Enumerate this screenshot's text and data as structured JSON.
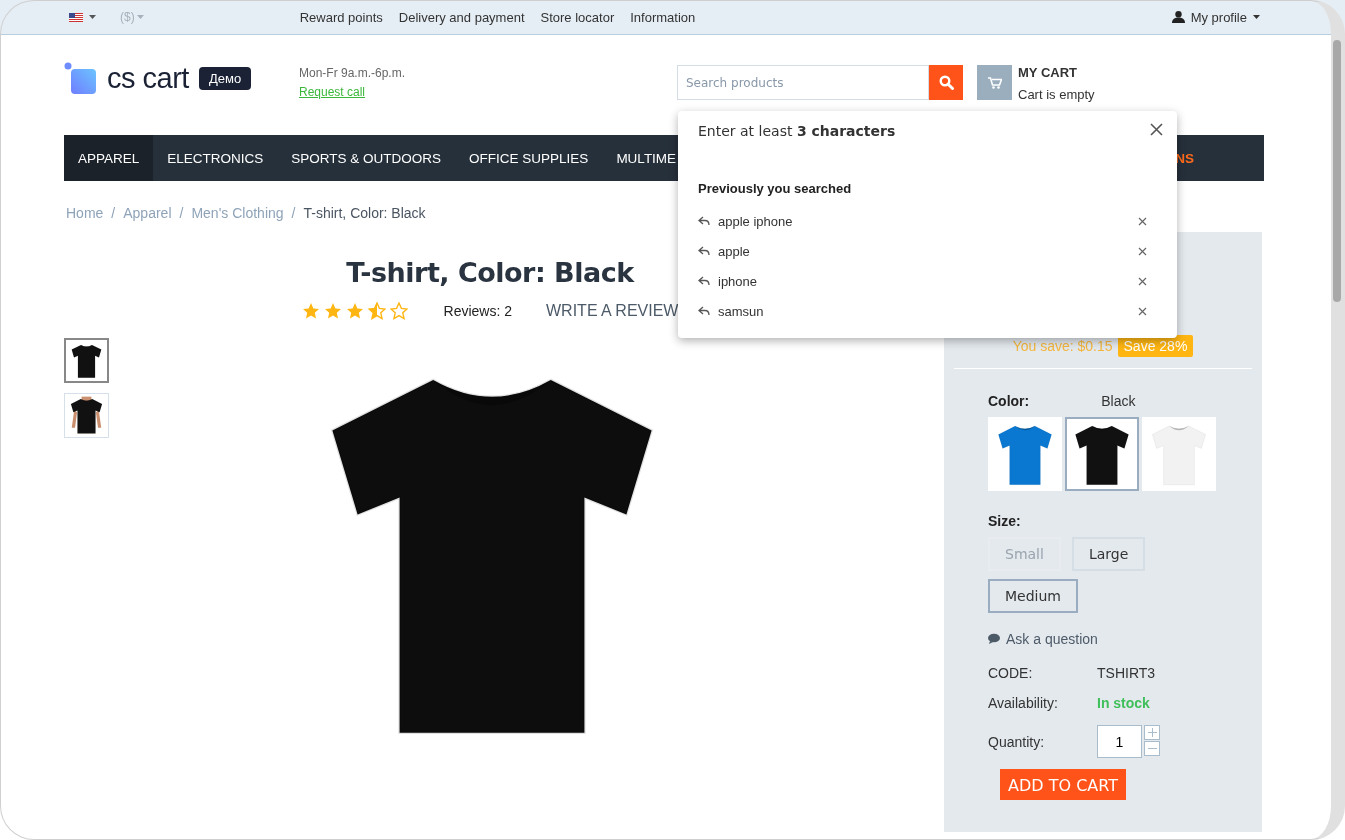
{
  "top_bar": {
    "language": {
      "kind": "flag"
    },
    "currency": {
      "label": "($)",
      "disabled": true
    },
    "links": [
      "Reward points",
      "Delivery and payment",
      "Store locator",
      "Information"
    ],
    "profile": "My profile"
  },
  "header": {
    "logo": {
      "text": "cs cart",
      "badge": "Демо"
    },
    "hours": "Mon-Fr 9a.m.-6p.m.",
    "request_call": "Request call",
    "search": {
      "placeholder": "Search products"
    },
    "cart": {
      "title": "MY CART",
      "status": "Cart is empty"
    }
  },
  "nav": [
    {
      "label": "APPAREL",
      "selected": true,
      "kind": "normal"
    },
    {
      "label": "ELECTRONICS",
      "selected": false,
      "kind": "normal"
    },
    {
      "label": "SPORTS & OUTDOORS",
      "selected": false,
      "kind": "normal"
    },
    {
      "label": "OFFICE SUPPLIES",
      "selected": false,
      "kind": "normal"
    },
    {
      "label": "MULTIME",
      "selected": false,
      "kind": "normal"
    },
    {
      "label": "NS",
      "selected": false,
      "kind": "promo"
    }
  ],
  "breadcrumbs": {
    "separator": "/",
    "items": [
      "Home",
      "Apparel",
      "Men's Clothing",
      "T-shirt, Color: Black"
    ]
  },
  "product": {
    "title": "T-shirt, Color: Black",
    "rating": {
      "stars": 3.5,
      "reviews": "Reviews: 2",
      "write_review": "WRITE A REVIEW"
    },
    "thumbnails": [
      {
        "kind": "picture",
        "selected": true
      },
      {
        "kind": "picture",
        "selected": false
      }
    ],
    "savings": {
      "text": "You save: $0.15",
      "badge": "Save 28%"
    },
    "color": {
      "label": "Color:",
      "value": "Black",
      "options": [
        {
          "kind": "picture",
          "color": "#0a78d0",
          "selected": false
        },
        {
          "kind": "picture",
          "color": "#111111",
          "selected": true
        },
        {
          "kind": "picture",
          "color": "#f2f2f2",
          "selected": false
        }
      ]
    },
    "size": {
      "label": "Size:",
      "options": [
        {
          "label": "Small",
          "disabled": true,
          "selected": false
        },
        {
          "label": "Large",
          "disabled": false,
          "selected": false
        },
        {
          "label": "Medium",
          "disabled": false,
          "selected": true
        }
      ]
    },
    "ask_question": "Ask a question",
    "details": [
      {
        "label": "CODE:",
        "value": "TSHIRT3",
        "kind": "text"
      },
      {
        "label": "Availability:",
        "value": "In stock",
        "kind": "stock"
      }
    ],
    "quantity": {
      "label": "Quantity:",
      "value": "1"
    },
    "add_to_cart": "ADD TO CART"
  },
  "search_dropdown": {
    "hint": "Enter at least **3 characters**",
    "history_title": "Previously you searched",
    "history": [
      "apple iphone",
      "apple",
      "iphone",
      "samsun"
    ]
  }
}
